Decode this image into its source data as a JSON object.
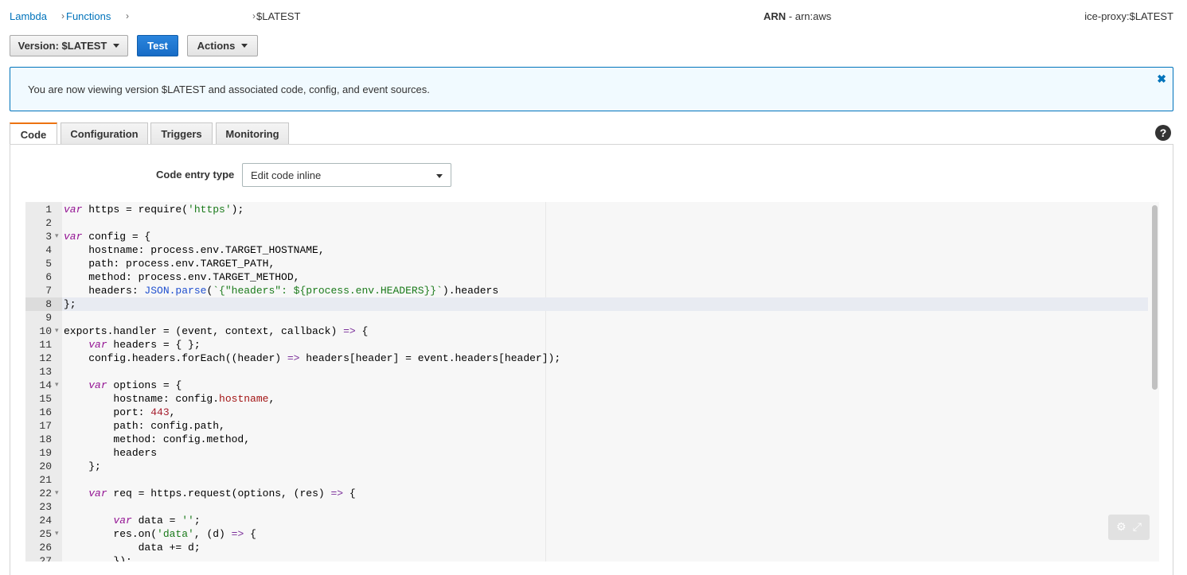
{
  "breadcrumb": {
    "lambda": "Lambda",
    "functions": "Functions",
    "version": "$LATEST",
    "sep": "›"
  },
  "arn": {
    "label": "ARN",
    "value": " - arn:aws"
  },
  "function_version": "ice-proxy:$LATEST",
  "toolbar": {
    "version_label": "Version: $LATEST",
    "test_label": "Test",
    "actions_label": "Actions"
  },
  "banner": {
    "message": "You are now viewing version $LATEST and associated code, config, and event sources.",
    "close": "✖"
  },
  "tabs": {
    "code": "Code",
    "configuration": "Configuration",
    "triggers": "Triggers",
    "monitoring": "Monitoring",
    "help": "?"
  },
  "code_entry": {
    "label": "Code entry type",
    "value": "Edit code inline"
  },
  "editor": {
    "active_line": 8,
    "fold_lines": [
      3,
      10,
      14,
      22,
      25
    ],
    "lines": [
      "var https = require('https');",
      "",
      "var config = {",
      "    hostname: process.env.TARGET_HOSTNAME,",
      "    path: process.env.TARGET_PATH,",
      "    method: process.env.TARGET_METHOD,",
      "    headers: JSON.parse(`{\"headers\": ${process.env.HEADERS}}`).headers",
      "};",
      "",
      "exports.handler = (event, context, callback) => {",
      "    var headers = { };",
      "    config.headers.forEach((header) => headers[header] = event.headers[header]);",
      "",
      "    var options = {",
      "        hostname: config.hostname,",
      "        port: 443,",
      "        path: config.path,",
      "        method: config.method,",
      "        headers",
      "    };",
      "",
      "    var req = https.request(options, (res) => {",
      "",
      "        var data = '';",
      "        res.on('data', (d) => {",
      "            data += d;",
      "        });"
    ],
    "tools": {
      "settings_icon": "gear-icon",
      "fullscreen_icon": "expand-icon"
    }
  }
}
